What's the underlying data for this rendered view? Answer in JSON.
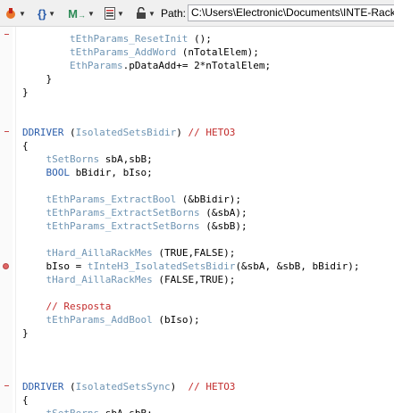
{
  "toolbar": {
    "path_label": "Path:",
    "path_value": "C:\\Users\\Electronic\\Documents\\INTE-Rack-pro",
    "icons": [
      "bookmark-icon",
      "braces-icon",
      "m-arrow-icon",
      "document-list-icon",
      "lock-icon"
    ],
    "accent_colors": {
      "brand": "#d4401c",
      "blue": "#2a5caa",
      "green": "#2e8b57"
    }
  },
  "code": [
    {
      "segs": [
        {
          "cls": "t",
          "text": "        tEthParams_ResetInit"
        },
        {
          "cls": "",
          "text": " ();"
        }
      ]
    },
    {
      "segs": [
        {
          "cls": "t",
          "text": "        tEthParams_AddWord"
        },
        {
          "cls": "",
          "text": " (nTotalElem);"
        }
      ]
    },
    {
      "segs": [
        {
          "cls": "t",
          "text": "        EthParams"
        },
        {
          "cls": "",
          "text": ".pDataAdd+= 2*nTotalElem;"
        }
      ]
    },
    {
      "segs": [
        {
          "cls": "",
          "text": "    }"
        }
      ]
    },
    {
      "segs": [
        {
          "cls": "",
          "text": "}"
        }
      ]
    },
    {
      "segs": []
    },
    {
      "segs": []
    },
    {
      "segs": [
        {
          "cls": "k",
          "text": "DDRIVER"
        },
        {
          "cls": "",
          "text": " ("
        },
        {
          "cls": "t",
          "text": "IsolatedSetsBidir"
        },
        {
          "cls": "",
          "text": ") "
        },
        {
          "cls": "c",
          "text": "// HETO3"
        }
      ]
    },
    {
      "segs": [
        {
          "cls": "",
          "text": "{"
        }
      ]
    },
    {
      "segs": [
        {
          "cls": "t",
          "text": "    tSetBorns"
        },
        {
          "cls": "",
          "text": " sbA,sbB;"
        }
      ]
    },
    {
      "segs": [
        {
          "cls": "k",
          "text": "    BOOL"
        },
        {
          "cls": "",
          "text": " bBidir, bIso;"
        }
      ]
    },
    {
      "segs": []
    },
    {
      "segs": [
        {
          "cls": "t",
          "text": "    tEthParams_ExtractBool"
        },
        {
          "cls": "",
          "text": " (&bBidir);"
        }
      ]
    },
    {
      "segs": [
        {
          "cls": "t",
          "text": "    tEthParams_ExtractSetBorns"
        },
        {
          "cls": "",
          "text": " (&sbA);"
        }
      ]
    },
    {
      "segs": [
        {
          "cls": "t",
          "text": "    tEthParams_ExtractSetBorns"
        },
        {
          "cls": "",
          "text": " (&sbB);"
        }
      ]
    },
    {
      "segs": []
    },
    {
      "segs": [
        {
          "cls": "t",
          "text": "    tHard_AillaRackMes"
        },
        {
          "cls": "",
          "text": " (TRUE,FALSE);"
        }
      ]
    },
    {
      "segs": [
        {
          "cls": "",
          "text": "    bIso = "
        },
        {
          "cls": "t",
          "text": "tInteH3_IsolatedSetsBidir"
        },
        {
          "cls": "",
          "text": "(&sbA, &sbB, bBidir);"
        }
      ]
    },
    {
      "segs": [
        {
          "cls": "t",
          "text": "    tHard_AillaRackMes"
        },
        {
          "cls": "",
          "text": " (FALSE,TRUE);"
        }
      ]
    },
    {
      "segs": []
    },
    {
      "segs": [
        {
          "cls": "c",
          "text": "    // Resposta"
        }
      ]
    },
    {
      "segs": [
        {
          "cls": "t",
          "text": "    tEthParams_AddBool"
        },
        {
          "cls": "",
          "text": " (bIso);"
        }
      ]
    },
    {
      "segs": [
        {
          "cls": "",
          "text": "}"
        }
      ]
    },
    {
      "segs": []
    },
    {
      "segs": []
    },
    {
      "segs": []
    },
    {
      "segs": [
        {
          "cls": "k",
          "text": "DDRIVER"
        },
        {
          "cls": "",
          "text": " ("
        },
        {
          "cls": "t",
          "text": "IsolatedSetsSync"
        },
        {
          "cls": "",
          "text": ")  "
        },
        {
          "cls": "c",
          "text": "// HETO3"
        }
      ]
    },
    {
      "segs": [
        {
          "cls": "",
          "text": "{"
        }
      ]
    },
    {
      "segs": [
        {
          "cls": "t",
          "text": "    tSetBorns"
        },
        {
          "cls": "",
          "text": " sbA,sbB;"
        }
      ]
    }
  ]
}
